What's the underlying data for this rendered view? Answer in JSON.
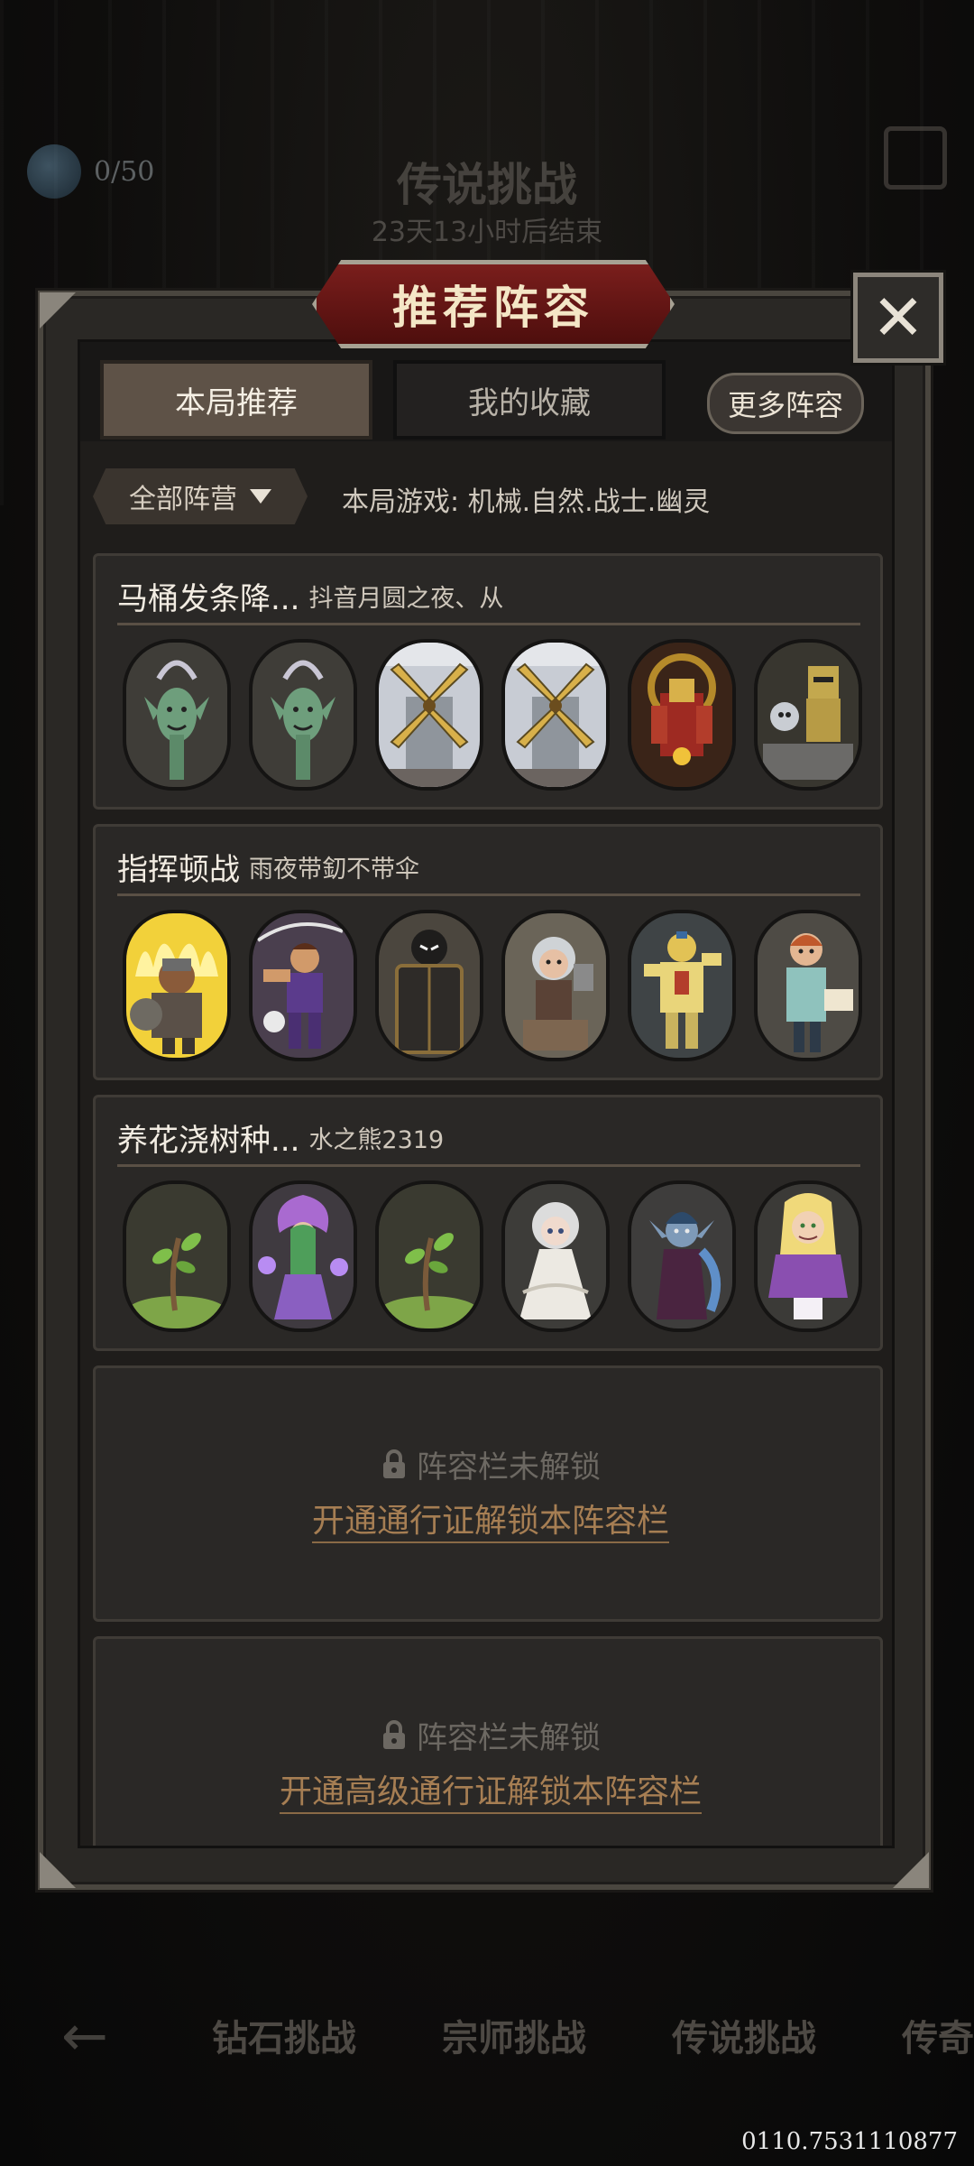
{
  "background": {
    "resource_count": "0/50",
    "title": "传说挑战",
    "timer": "23天13小时后结束",
    "nav_tabs": [
      "钻石挑战",
      "宗师挑战",
      "传说挑战",
      "传奇"
    ],
    "footer_code": "0110.7531110877"
  },
  "modal": {
    "title": "推荐阵容",
    "close_icon": "close-icon"
  },
  "tabs": {
    "current": "本局推荐",
    "favorites": "我的收藏",
    "more": "更多阵容"
  },
  "filter": {
    "faction_label": "全部阵营",
    "game_info": "本局游戏: 机械.自然.战士.幽灵"
  },
  "lineups": [
    {
      "name": "马桶发条降...",
      "author": "抖音月圆之夜、从",
      "heroes": [
        "goblin-spirit",
        "goblin-spirit",
        "windmill",
        "windmill",
        "red-mech",
        "robot-knight"
      ]
    },
    {
      "name": "指挥顿战",
      "author": "雨夜带釖不带伞",
      "heroes": [
        "fire-dwarf",
        "purple-warrior",
        "dark-shield",
        "white-haired-girl",
        "golden-paladin",
        "red-haired-officer"
      ]
    },
    {
      "name": "养花浇树种...",
      "author": "水之熊2319",
      "heroes": [
        "sapling",
        "flower-fairy",
        "sapling",
        "white-doll",
        "dark-elf",
        "elf-princess"
      ]
    }
  ],
  "locked_slots": [
    {
      "status": "阵容栏未解锁",
      "unlock": "开通通行证解锁本阵容栏"
    },
    {
      "status": "阵容栏未解锁",
      "unlock": "开通高级通行证解锁本阵容栏"
    }
  ],
  "colors": {
    "accent_red": "#7a1e1c",
    "link_gold": "#a67e53",
    "panel": "#2a2826"
  }
}
